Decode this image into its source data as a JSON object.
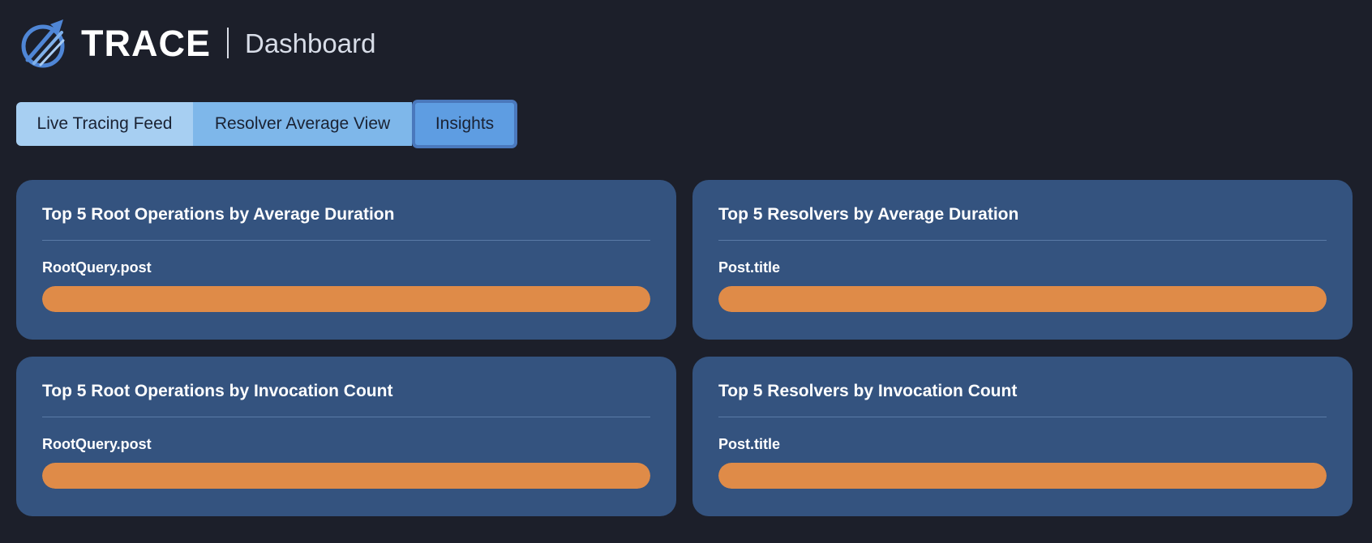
{
  "header": {
    "brand": "TRACE",
    "subtitle": "Dashboard",
    "logo_icon": "trace-logo-icon"
  },
  "tabs": [
    {
      "label": "Live Tracing Feed",
      "active": false
    },
    {
      "label": "Resolver Average View",
      "active": false
    },
    {
      "label": "Insights",
      "active": true
    }
  ],
  "colors": {
    "background": "#1c1f2a",
    "card": "#34537f",
    "bar": "#df8b48",
    "tab_live": "#a7cff2",
    "tab_resolver": "#7eb7ea",
    "tab_active": "#5e9de2"
  },
  "cards": [
    {
      "title": "Top 5 Root Operations by Average Duration",
      "items": [
        {
          "label": "RootQuery.post",
          "fraction": 1.0
        }
      ]
    },
    {
      "title": "Top 5 Resolvers by Average Duration",
      "items": [
        {
          "label": "Post.title",
          "fraction": 1.0
        }
      ]
    },
    {
      "title": "Top 5 Root Operations by Invocation Count",
      "items": [
        {
          "label": "RootQuery.post",
          "fraction": 1.0
        }
      ]
    },
    {
      "title": "Top 5 Resolvers by Invocation Count",
      "items": [
        {
          "label": "Post.title",
          "fraction": 1.0
        }
      ]
    }
  ]
}
